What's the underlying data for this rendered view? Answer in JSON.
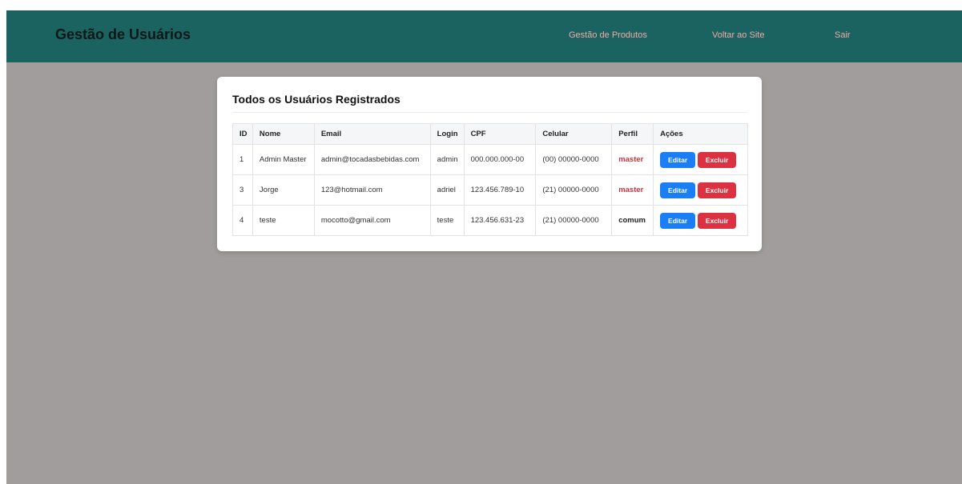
{
  "header": {
    "brand": "Gestão de Usuários",
    "links": [
      "Gestão de Produtos",
      "Voltar ao Site",
      "Sair"
    ]
  },
  "main": {
    "title": "Todos os Usuários Registrados",
    "table": {
      "columns": [
        "ID",
        "Nome",
        "Email",
        "Login",
        "CPF",
        "Celular",
        "Perfil",
        "Ações"
      ],
      "rows": [
        {
          "id": "1",
          "nome": "Admin Master",
          "email": "admin@tocadasbebidas.com",
          "login": "admin",
          "cpf": "000.000.000-00",
          "celular": "(00) 00000-0000",
          "perfil": "master"
        },
        {
          "id": "3",
          "nome": "Jorge",
          "email": "123@hotmail.com",
          "login": "adriel",
          "cpf": "123.456.789-10",
          "celular": "(21) 00000-0000",
          "perfil": "master"
        },
        {
          "id": "4",
          "nome": "teste",
          "email": "mocotto@gmail.com",
          "login": "teste",
          "cpf": "123.456.631-23",
          "celular": "(21) 00000-0000",
          "perfil": "comum"
        }
      ],
      "actions": {
        "edit_label": "Editar",
        "delete_label": "Excluir"
      }
    }
  },
  "colors": {
    "navbar": "#1b6361",
    "background": "#a09d9c",
    "perfil_master": "#d32f3a",
    "edit_button": "#1a7ef6",
    "delete_button": "#dc3141"
  }
}
